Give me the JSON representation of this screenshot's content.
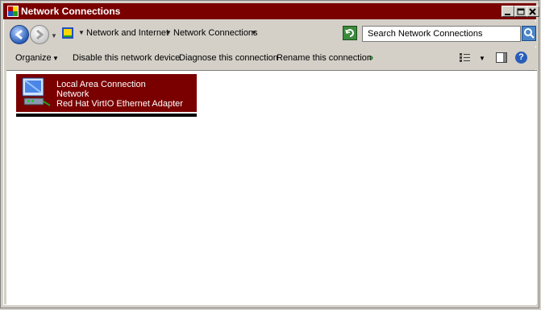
{
  "window": {
    "title": "Network Connections",
    "title_bar_color": "#7a0000"
  },
  "title_buttons": {
    "minimize_icon": "minimize-icon",
    "maximize_icon": "maximize-icon",
    "close_icon": "close-icon"
  },
  "address_bar": {
    "breadcrumbs": [
      "Network and Internet",
      "Network Connections"
    ],
    "search_placeholder": "Search Network Connections"
  },
  "command_bar": {
    "organize_label": "Organize",
    "disable_label": "Disable this network device",
    "diagnose_label": "Diagnose this connection",
    "rename_label": "Rename this connection",
    "overflow_label": "»"
  },
  "help": {
    "label": "?"
  },
  "connections": [
    {
      "name": "Local Area Connection",
      "network": "Network",
      "adapter": "Red Hat VirtIO Ethernet Adapter",
      "selected": true
    }
  ]
}
